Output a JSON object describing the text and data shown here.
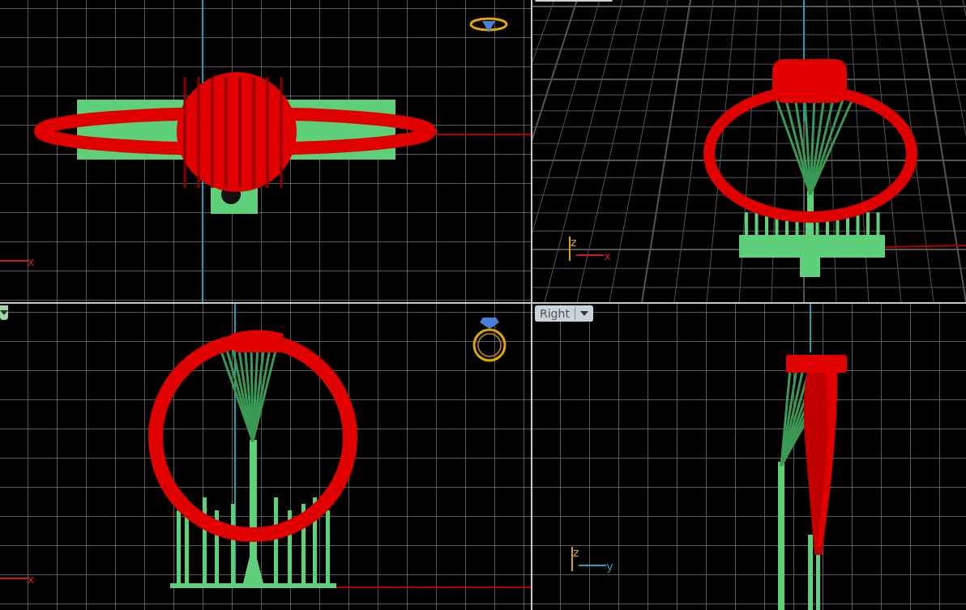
{
  "viewports": [
    {
      "kind": "top",
      "view_icon": {
        "kind": "side"
      },
      "axes": [
        {
          "kind": "horizontal",
          "label": "x",
          "color": "#d01818"
        }
      ]
    },
    {
      "kind": "perspective",
      "tab": {
        "kind": "cut"
      },
      "axes": [
        {
          "kind": "vertical",
          "label": "z",
          "color": "#d4a417"
        },
        {
          "kind": "horizontal",
          "label": "x",
          "color": "#d01818"
        }
      ]
    },
    {
      "kind": "front",
      "tab": {
        "kind": "arrow"
      },
      "view_icon": {
        "kind": "front"
      },
      "axes": [
        {
          "kind": "horizontal",
          "label": "x",
          "color": "#d01818"
        }
      ]
    },
    {
      "kind": "right",
      "tab": {
        "kind": "full",
        "label": "Right"
      },
      "axes": [
        {
          "kind": "vertical",
          "label": "z",
          "color": "#d4a417"
        },
        {
          "kind": "horizontal",
          "label": "y",
          "color": "#20a8b8"
        }
      ]
    }
  ]
}
